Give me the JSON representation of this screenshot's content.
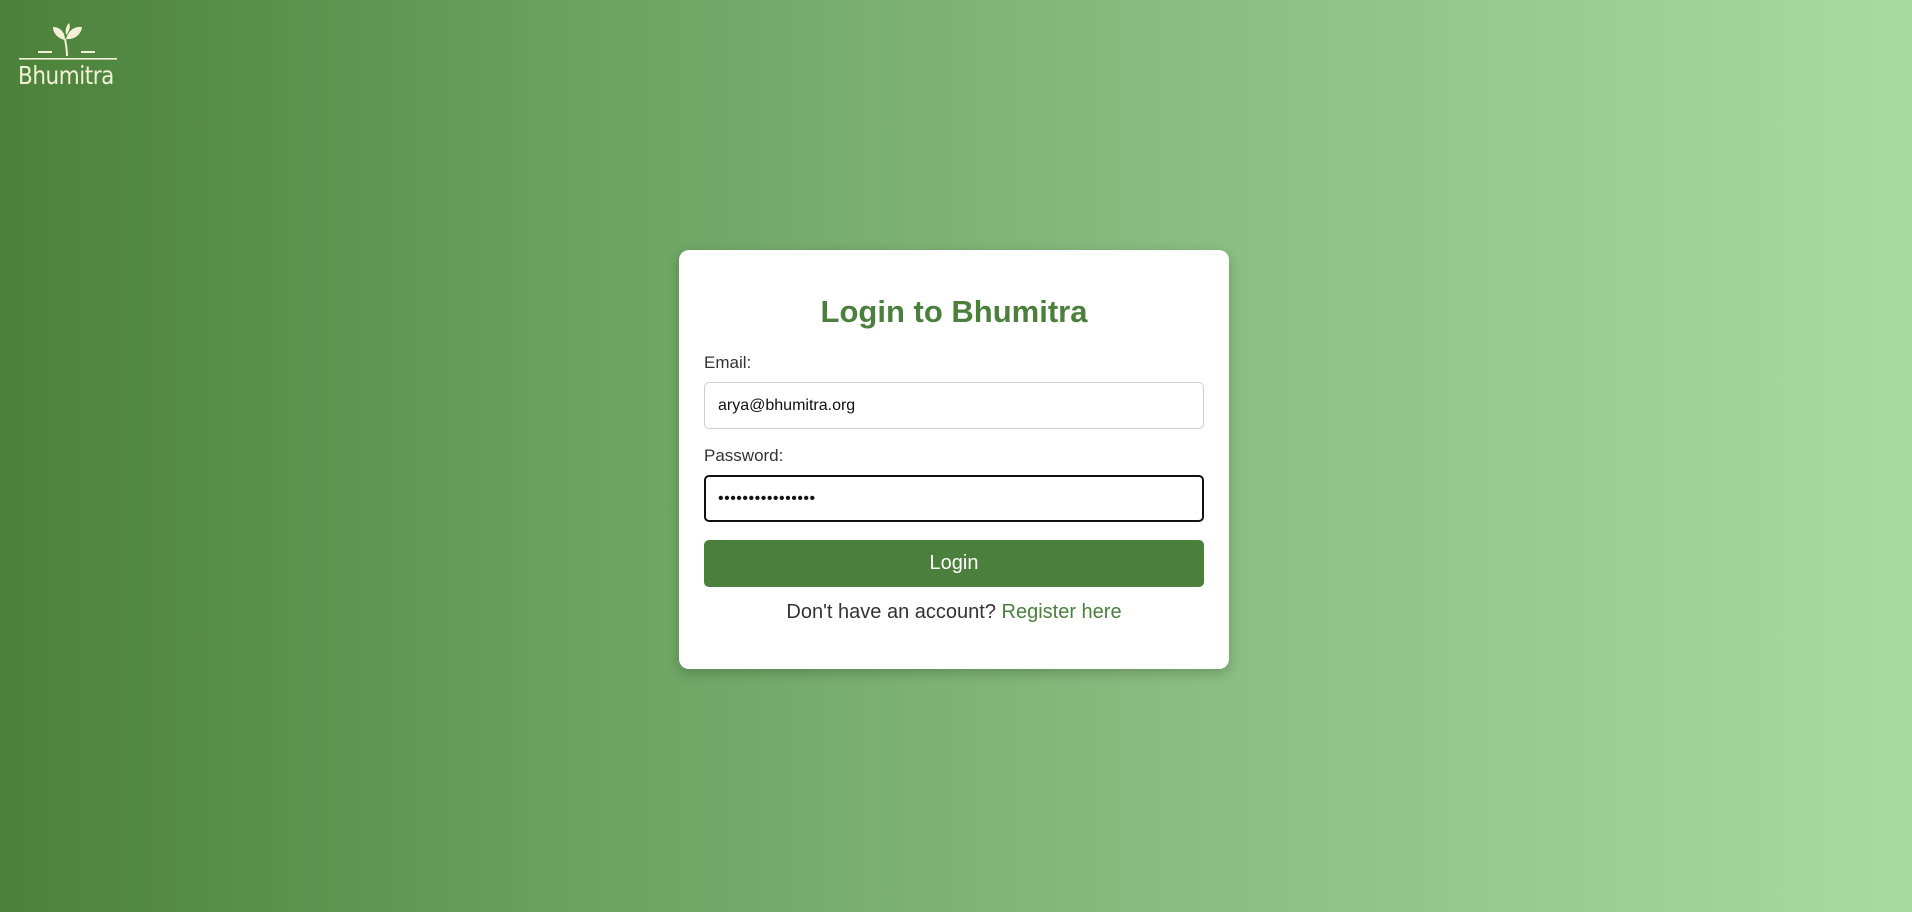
{
  "brand": {
    "logo_text": "Bhumitra",
    "logo_icon": "sprout-icon"
  },
  "login": {
    "title": "Login to Bhumitra",
    "email_label": "Email:",
    "email_value": "arya@bhumitra.org",
    "password_label": "Password:",
    "password_value": "••••••••••••••••",
    "button_label": "Login",
    "register_prompt": "Don't have an account?",
    "register_link": "Register here"
  },
  "colors": {
    "accent": "#4a7f3c",
    "gradient_start": "#4b8139",
    "gradient_end": "#a8dba0",
    "logo": "#f4f0d8"
  }
}
